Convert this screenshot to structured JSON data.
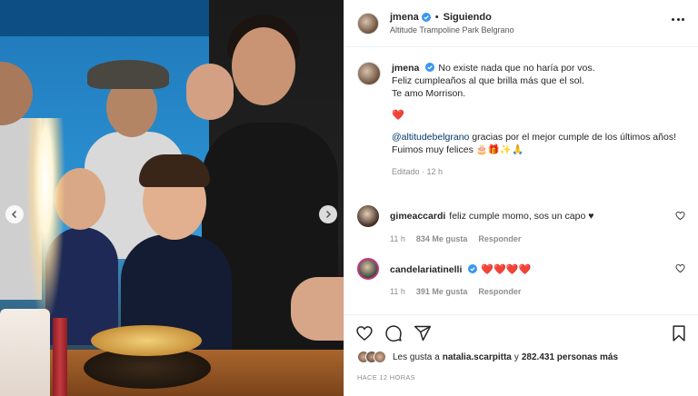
{
  "post": {
    "username": "jmena",
    "follow_status": "Siguiendo",
    "dot": "•",
    "location": "Altitude Trampoline Park Belgrano"
  },
  "caption": {
    "line1": "No existe nada que no haría por vos.",
    "line2": "Feliz cumpleaños al que brilla más que el sol.",
    "line3": "Te amo Morrison.",
    "heart": "❤️",
    "mention": "@altitudebelgrano",
    "line4_rest": " gracias por el mejor cumple de los últimos años!",
    "line5": "Fuimos muy felices 🎂🎁✨🙏",
    "edited": "Editado · 12 h"
  },
  "comments": [
    {
      "username": "gimeaccardi",
      "text": "feliz cumple momo, sos un capo ♥",
      "time": "11 h",
      "likes": "834 Me gusta",
      "reply": "Responder"
    },
    {
      "username": "candelariatinelli",
      "text": "❤️❤️❤️❤️",
      "time": "11 h",
      "likes": "391 Me gusta",
      "reply": "Responder"
    }
  ],
  "likes": {
    "prefix": "Les gusta a",
    "user": "natalia.scarpitta",
    "middle": "y",
    "count": "282.431 personas más"
  },
  "time_ago": "HACE 12 HORAS",
  "icons": {
    "like": "heart-icon",
    "comment": "comment-icon",
    "share": "paper-plane-icon",
    "save": "bookmark-icon",
    "more": "more-dots-icon",
    "verified": "verified-badge-icon",
    "prev": "chevron-left-icon",
    "next": "chevron-right-icon"
  },
  "colors": {
    "verified": "#3897f0",
    "mention": "#00376b",
    "heart": "#e0143b",
    "muted": "#8e8e8e"
  }
}
